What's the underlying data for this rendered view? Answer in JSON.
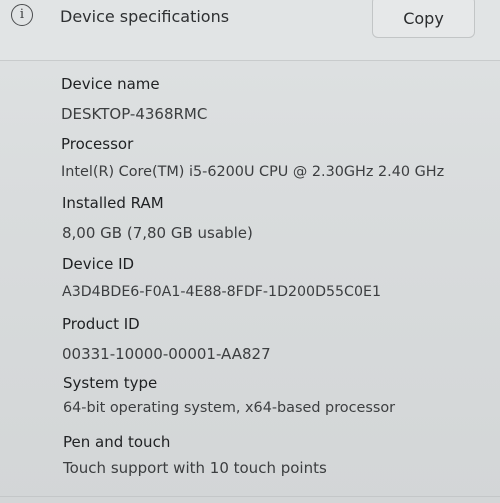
{
  "header": {
    "title": "Device specifications",
    "copy_label": "Copy",
    "info_glyph": "i"
  },
  "specs": [
    {
      "label": "Device name",
      "value": "DESKTOP-4368RMC"
    },
    {
      "label": "Processor",
      "value": "Intel(R) Core(TM) i5-6200U CPU @ 2.30GHz   2.40 GHz"
    },
    {
      "label": "Installed RAM",
      "value": "8,00 GB (7,80 GB usable)"
    },
    {
      "label": "Device ID",
      "value": "A3D4BDE6-F0A1-4E88-8FDF-1D200D55C0E1"
    },
    {
      "label": "Product ID",
      "value": "00331-10000-00001-AA827"
    },
    {
      "label": "System type",
      "value": "64-bit operating system, x64-based processor"
    },
    {
      "label": "Pen and touch",
      "value": "Touch support with 10 touch points"
    }
  ],
  "icons": {
    "info": "info-icon",
    "collapse": "chevron-up-icon"
  }
}
